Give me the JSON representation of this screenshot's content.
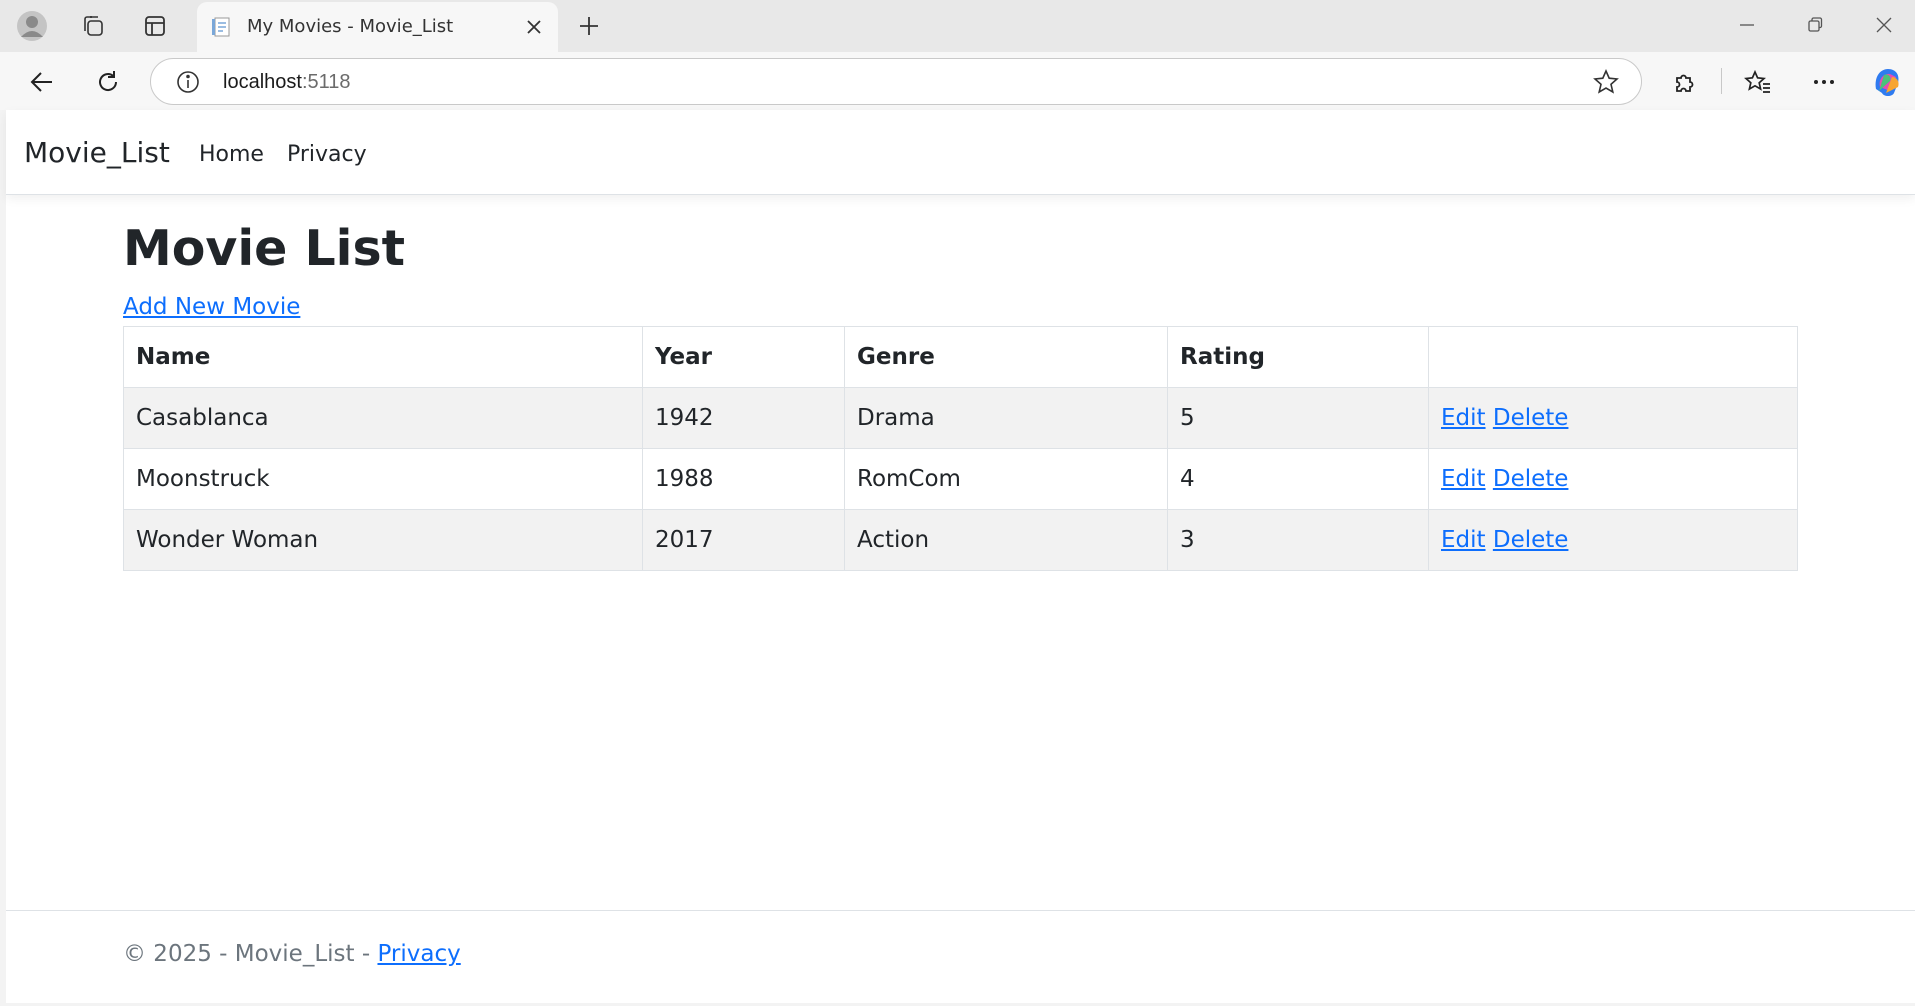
{
  "browser": {
    "tab_title": "My Movies - Movie_List",
    "address_host": "localhost",
    "address_port": ":5118"
  },
  "navbar": {
    "brand": "Movie_List",
    "links": [
      "Home",
      "Privacy"
    ]
  },
  "main": {
    "title": "Movie List",
    "add_link": "Add New Movie",
    "table": {
      "headers": [
        "Name",
        "Year",
        "Genre",
        "Rating",
        ""
      ],
      "rows": [
        {
          "name": "Casablanca",
          "year": "1942",
          "genre": "Drama",
          "rating": "5",
          "edit": "Edit",
          "delete": "Delete"
        },
        {
          "name": "Moonstruck",
          "year": "1988",
          "genre": "RomCom",
          "rating": "4",
          "edit": "Edit",
          "delete": "Delete"
        },
        {
          "name": "Wonder Woman",
          "year": "2017",
          "genre": "Action",
          "rating": "3",
          "edit": "Edit",
          "delete": "Delete"
        }
      ]
    }
  },
  "footer": {
    "text": "© 2025 - Movie_List - ",
    "privacy_link": "Privacy"
  }
}
